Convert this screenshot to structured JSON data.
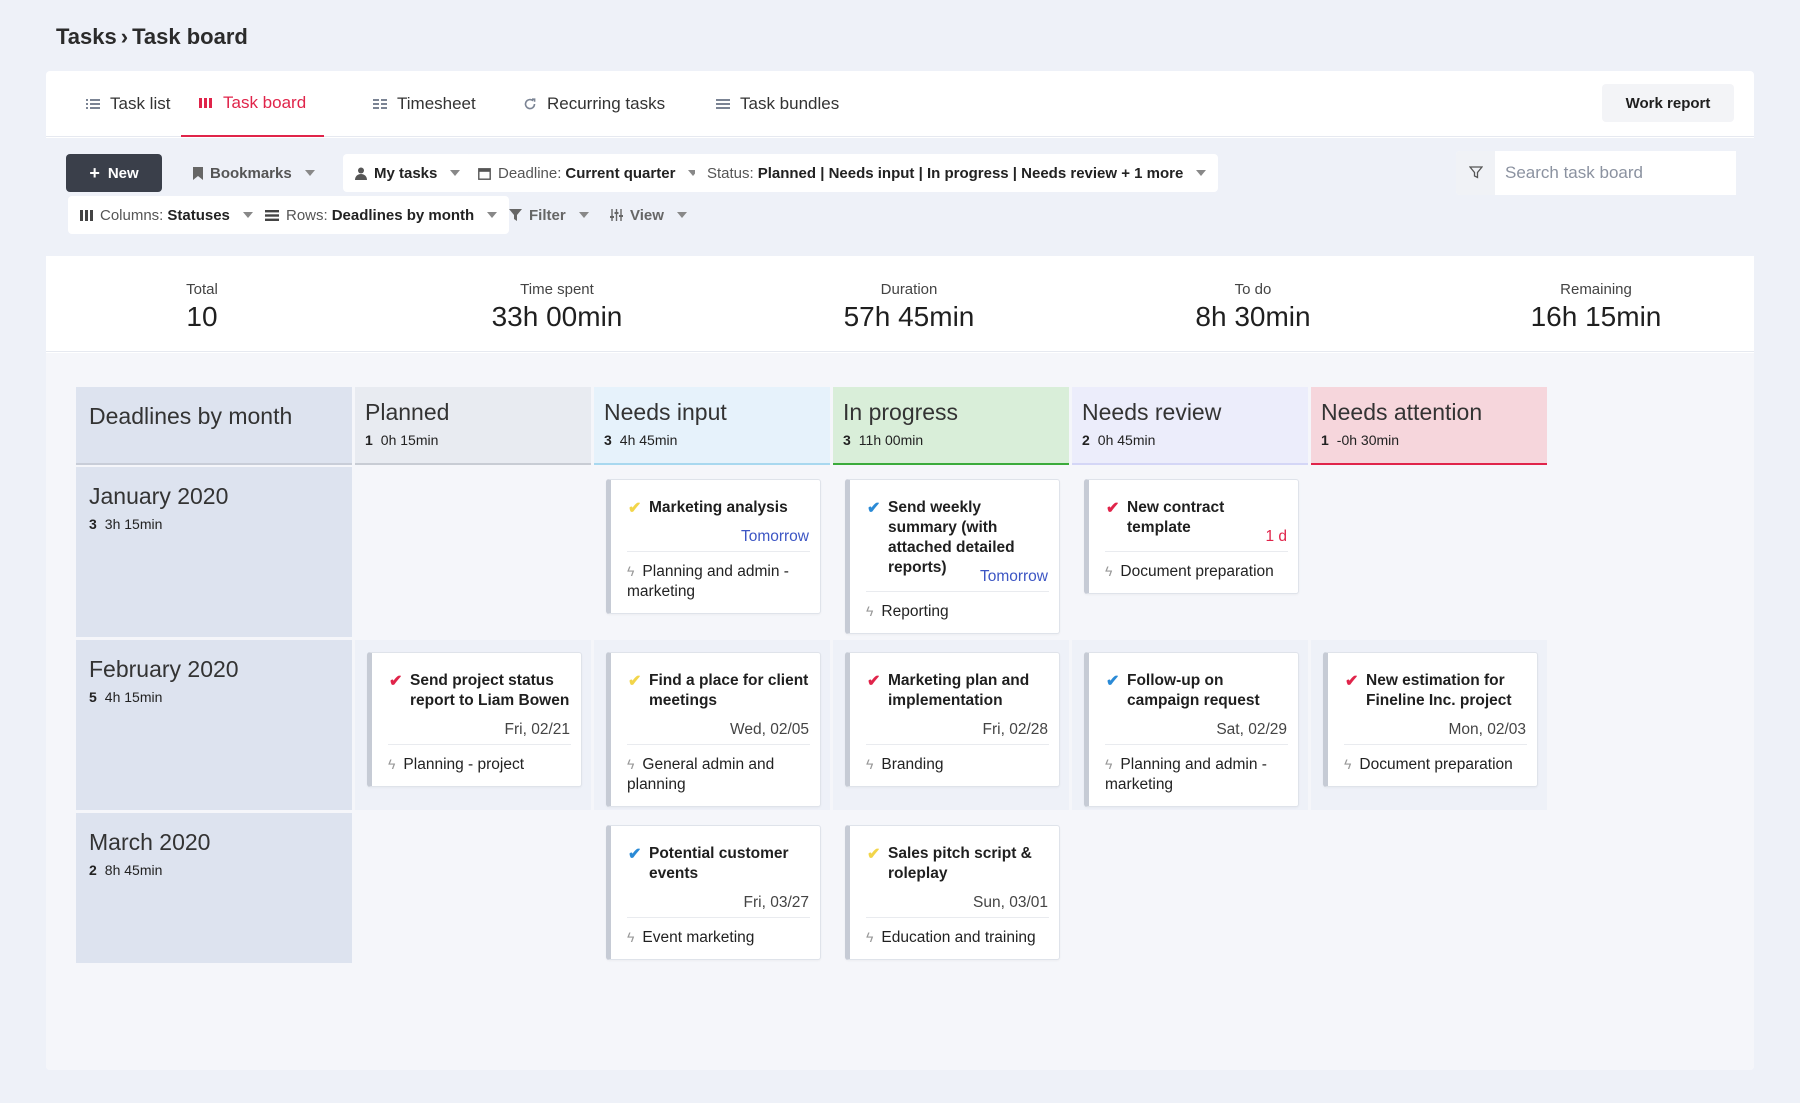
{
  "breadcrumb": {
    "section": "Tasks",
    "separator": "›",
    "page": "Task board"
  },
  "tabs": [
    {
      "label": "Task list",
      "icon": "list-icon"
    },
    {
      "label": "Task board",
      "icon": "board-icon",
      "active": true
    },
    {
      "label": "Timesheet",
      "icon": "grid-icon"
    },
    {
      "label": "Recurring tasks",
      "icon": "refresh-icon"
    },
    {
      "label": "Task bundles",
      "icon": "menu-icon"
    }
  ],
  "work_report_label": "Work report",
  "toolbar": {
    "new_label": "New",
    "bookmarks_label": "Bookmarks",
    "my_tasks_label": "My tasks",
    "deadline_key": "Deadline:",
    "deadline_value": "Current quarter",
    "status_key": "Status:",
    "status_value": "Planned | Needs input | In progress | Needs review + 1 more",
    "columns_key": "Columns:",
    "columns_value": "Statuses",
    "rows_key": "Rows:",
    "rows_value": "Deadlines by month",
    "filter_label": "Filter",
    "view_label": "View",
    "search_placeholder": "Search task board"
  },
  "stats": [
    {
      "label": "Total",
      "value": "10"
    },
    {
      "label": "Time spent",
      "value": "33h 00min"
    },
    {
      "label": "Duration",
      "value": "57h 45min"
    },
    {
      "label": "To do",
      "value": "8h 30min"
    },
    {
      "label": "Remaining",
      "value": "16h 15min"
    }
  ],
  "board": {
    "row_header": "Deadlines by month",
    "columns": [
      {
        "title": "Planned",
        "count": "1",
        "time": "0h 15min",
        "bg": "#e8ebf1",
        "accent": "#c8ccd4"
      },
      {
        "title": "Needs input",
        "count": "3",
        "time": "4h 45min",
        "bg": "#e6f2fb",
        "accent": "#a8d8ef"
      },
      {
        "title": "In progress",
        "count": "3",
        "time": "11h 00min",
        "bg": "#d9eed9",
        "accent": "#3bab3b"
      },
      {
        "title": "Needs review",
        "count": "2",
        "time": "0h 45min",
        "bg": "#ecedfb",
        "accent": "#d4d6f6"
      },
      {
        "title": "Needs attention",
        "count": "1",
        "time": "-0h 30min",
        "bg": "#f6d6dc",
        "accent": "#e0244a"
      }
    ],
    "rows": [
      {
        "title": "January 2020",
        "count": "3",
        "time": "3h 15min"
      },
      {
        "title": "February 2020",
        "count": "5",
        "time": "4h 15min"
      },
      {
        "title": "March 2020",
        "count": "2",
        "time": "8h 45min"
      }
    ],
    "cards": [
      {
        "row": 0,
        "col": 1,
        "title": "Marketing analysis",
        "check_color": "#f2d54a",
        "due": "Tomorrow",
        "due_color": "#3d56c4",
        "project": "Planning and admin - marketing"
      },
      {
        "row": 0,
        "col": 2,
        "title": "Send weekly summary (with attached detailed reports)",
        "check_color": "#2a8ad6",
        "due": "Tomorrow",
        "due_color": "#3d56c4",
        "project": "Reporting"
      },
      {
        "row": 0,
        "col": 3,
        "title": "New contract template",
        "check_color": "#e0244a",
        "due": "1 d",
        "due_color": "#e0244a",
        "project": "Document preparation"
      },
      {
        "row": 1,
        "col": 0,
        "title": "Send project status report to Liam Bowen",
        "check_color": "#e0244a",
        "due": "Fri, 02/21",
        "due_color": "#444",
        "project": "Planning - project"
      },
      {
        "row": 1,
        "col": 1,
        "title": "Find a place for client meetings",
        "check_color": "#f2d54a",
        "due": "Wed, 02/05",
        "due_color": "#444",
        "project": "General admin and planning"
      },
      {
        "row": 1,
        "col": 2,
        "title": "Marketing plan and implementation",
        "check_color": "#e0244a",
        "due": "Fri, 02/28",
        "due_color": "#444",
        "project": "Branding"
      },
      {
        "row": 1,
        "col": 3,
        "title": "Follow-up on campaign request",
        "check_color": "#2a8ad6",
        "due": "Sat, 02/29",
        "due_color": "#444",
        "project": "Planning and admin - marketing"
      },
      {
        "row": 1,
        "col": 4,
        "title": "New estimation for Fineline Inc. project",
        "check_color": "#e0244a",
        "due": "Mon, 02/03",
        "due_color": "#444",
        "project": "Document preparation"
      },
      {
        "row": 2,
        "col": 1,
        "title": "Potential customer events",
        "check_color": "#2a8ad6",
        "due": "Fri, 03/27",
        "due_color": "#444",
        "project": "Event marketing"
      },
      {
        "row": 2,
        "col": 2,
        "title": "Sales pitch script & roleplay",
        "check_color": "#f2d54a",
        "due": "Sun, 03/01",
        "due_color": "#444",
        "project": "Education and training"
      }
    ]
  }
}
